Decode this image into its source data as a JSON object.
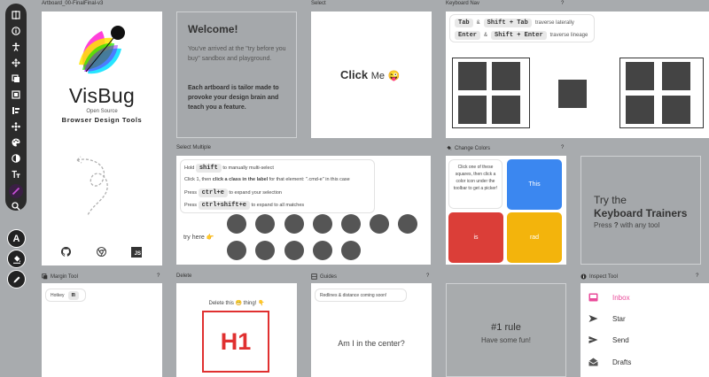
{
  "toolbar": {
    "tools": [
      "guides",
      "inspect",
      "accessibility",
      "move",
      "margin",
      "padding",
      "align",
      "hueshift",
      "boxshadow",
      "position",
      "font",
      "text",
      "search"
    ],
    "text_color_letter": "A"
  },
  "artboards": {
    "main": {
      "label": "Artboard_00-FinalFinal-v3"
    },
    "welcome": {
      "label": "",
      "title": "Welcome!",
      "intro": "You've arrived at the \"try before you buy\" sandbox and playground.",
      "bold": "Each artboard is tailor made to provoke your design brain and teach you a feature."
    },
    "select": {
      "label": "Select",
      "click": "Click",
      "me": "Me",
      "emoji": "😜"
    },
    "keyboard_nav": {
      "label": "Keyboard Nav",
      "row1": {
        "k1": "Tab",
        "amp": "&",
        "k2": "Shift + Tab",
        "desc": "traverse laterally"
      },
      "row2": {
        "k1": "Enter",
        "amp": "&",
        "k2": "Shift + Enter",
        "desc": "traverse lineage"
      }
    },
    "select_multiple": {
      "label": "Select Multiple",
      "line1_pre": "Hold",
      "line1_key": "shift",
      "line1_post": "to manually multi-select",
      "line2_pre": "Click 1, then",
      "line2_bold": "click a class in the label",
      "line2_post": "for that element: \".cmd-e\" in this case",
      "line3_pre": "Press",
      "line3_key": "ctrl+e",
      "line3_post": "to expand your selection",
      "line4_pre": "Press",
      "line4_key": "ctrl+shift+e",
      "line4_post": "to expand to all matches",
      "try": "try here",
      "try_emoji": "👉"
    },
    "change_colors": {
      "label": "Change Colors",
      "tip": "Click one of these squares, then click a color icon under the toolbar to get a picker!",
      "blue": "This",
      "red": "is",
      "yellow": "rad",
      "colors": {
        "blue": "#3b87f0",
        "red": "#db3e38",
        "yellow": "#f3b40c"
      }
    },
    "keyboard_trainers": {
      "try": "Try the",
      "title": "Keyboard Trainers",
      "press": "Press",
      "q": "?",
      "rest": "with any tool"
    },
    "margin_tool": {
      "label": "Margin Tool",
      "hotkey": "Hotkey",
      "key": "m"
    },
    "delete": {
      "label": "Delete",
      "tip": "Delete this",
      "emoji1": "😁",
      "tip2": "thing!",
      "emoji2": "👇",
      "h1": "H1"
    },
    "guides": {
      "label": "Guides",
      "tip": "Redlines & distance coming soon!",
      "center": "Am I in the center?"
    },
    "rule": {
      "label": "",
      "title": "#1 rule",
      "sub": "Have some fun!"
    },
    "inspect_tool": {
      "label": "Inspect Tool",
      "items": [
        "Inbox",
        "Star",
        "Send",
        "Drafts"
      ],
      "accent": "#e94b9a"
    }
  },
  "branding": {
    "name": "VisBug",
    "tag1": "Open Source",
    "tag2": "Browser Design Tools",
    "js": "JS"
  }
}
